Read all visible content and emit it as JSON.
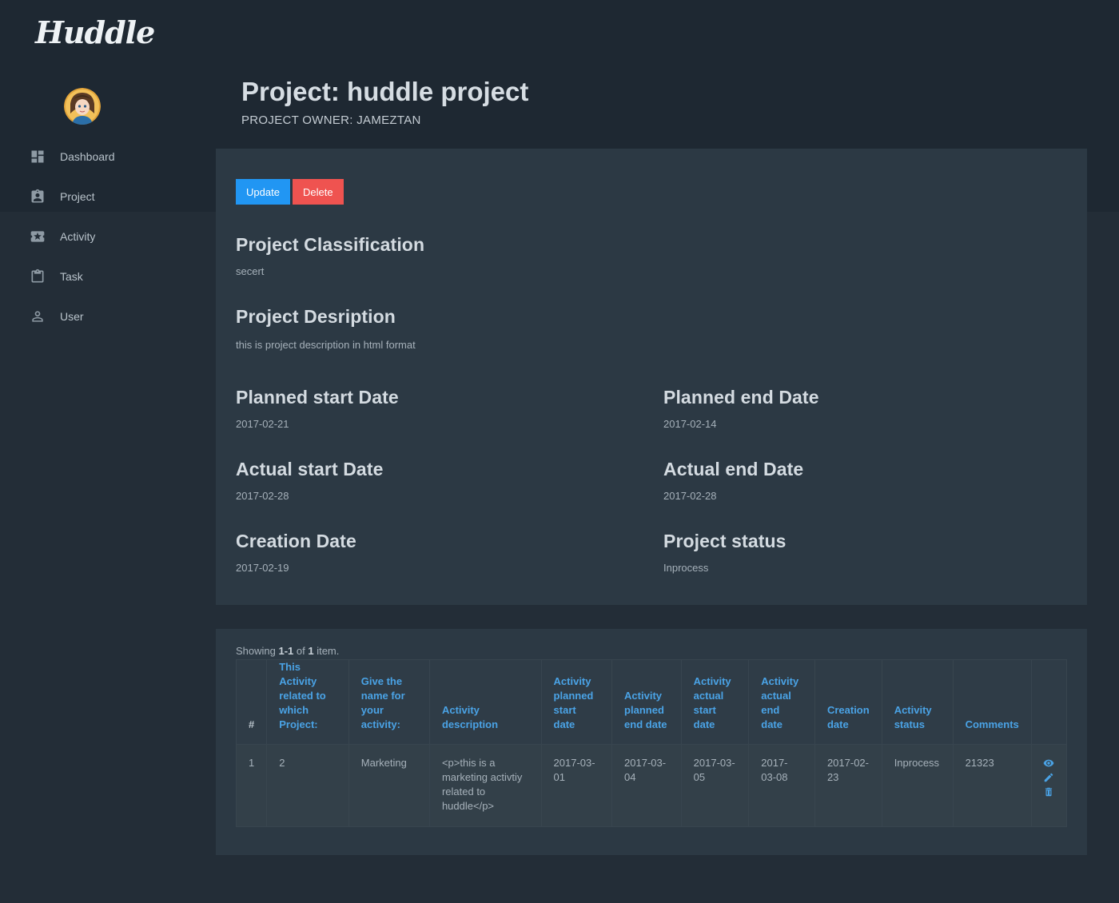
{
  "app": {
    "logo": "Huddle"
  },
  "sidebar": {
    "items": [
      {
        "label": "Dashboard",
        "icon": "dashboard-icon"
      },
      {
        "label": "Project",
        "icon": "project-badge-icon"
      },
      {
        "label": "Activity",
        "icon": "activity-ticket-icon"
      },
      {
        "label": "Task",
        "icon": "clipboard-icon"
      },
      {
        "label": "User",
        "icon": "user-icon"
      }
    ]
  },
  "header": {
    "title": "Project: huddle project",
    "owner": "PROJECT OWNER: JAMEZTAN"
  },
  "actions": {
    "update": "Update",
    "delete": "Delete"
  },
  "detail": {
    "classification": {
      "label": "Project Classification",
      "value": "secert"
    },
    "description": {
      "label": "Project Desription",
      "value": "this is project description in html format"
    },
    "planned_start": {
      "label": "Planned start Date",
      "value": "2017-02-21"
    },
    "planned_end": {
      "label": "Planned end Date",
      "value": "2017-02-14"
    },
    "actual_start": {
      "label": "Actual start Date",
      "value": "2017-02-28"
    },
    "actual_end": {
      "label": "Actual end Date",
      "value": "2017-02-28"
    },
    "creation": {
      "label": "Creation Date",
      "value": "2017-02-19"
    },
    "status": {
      "label": "Project status",
      "value": "Inprocess"
    }
  },
  "grid": {
    "summary": {
      "prefix": "Showing ",
      "range": "1-1",
      "mid": " of ",
      "total": "1",
      "suffix": " item."
    },
    "columns": [
      "#",
      "This Activity related to which Project:",
      "Give the name for your activity:",
      "Activity description",
      "Activity planned start date",
      "Activity planned end date",
      "Activity actual start date",
      "Activity actual end date",
      "Creation date",
      "Activity status",
      "Comments"
    ],
    "rows": [
      {
        "cells": [
          "1",
          "2",
          "Marketing",
          "<p>this is a marketing activtiy related to huddle</p>",
          "2017-03-01",
          "2017-03-04",
          "2017-03-05",
          "2017-03-08",
          "2017-02-23",
          "Inprocess",
          "21323"
        ],
        "actions": [
          "view-icon",
          "edit-pencil-icon",
          "trash-icon"
        ]
      }
    ]
  },
  "colors": {
    "background": "#232d37",
    "card": "#2c3944",
    "accent": "#2196f3",
    "danger": "#ef5350",
    "link": "#4aa3e6"
  }
}
